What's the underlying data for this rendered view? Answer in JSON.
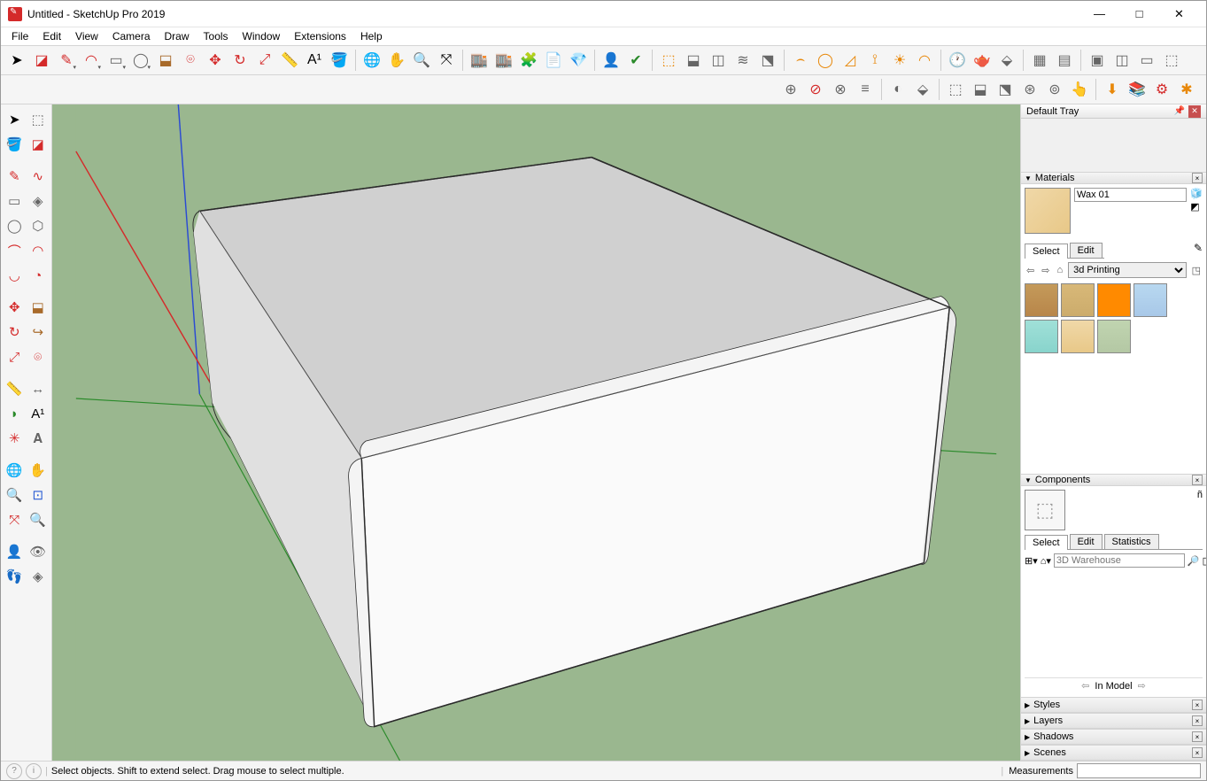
{
  "window": {
    "title": "Untitled - SketchUp Pro 2019",
    "controls": {
      "min": "—",
      "max": "□",
      "close": "✕"
    }
  },
  "menu": [
    "File",
    "Edit",
    "View",
    "Camera",
    "Draw",
    "Tools",
    "Window",
    "Extensions",
    "Help"
  ],
  "toolbar1": [
    {
      "name": "select-tool",
      "glyph": "➤",
      "cls": "",
      "dd": false,
      "sep": false
    },
    {
      "name": "eraser-tool",
      "glyph": "◪",
      "cls": "c-red",
      "dd": false,
      "sep": false
    },
    {
      "name": "line-tool",
      "glyph": "✎",
      "cls": "c-red",
      "dd": true,
      "sep": false
    },
    {
      "name": "arc-tool",
      "glyph": "◠",
      "cls": "c-red",
      "dd": true,
      "sep": false
    },
    {
      "name": "rectangle-tool",
      "glyph": "▭",
      "cls": "c-gray",
      "dd": true,
      "sep": false
    },
    {
      "name": "circle-tool",
      "glyph": "◯",
      "cls": "c-gray",
      "dd": true,
      "sep": false
    },
    {
      "name": "pushpull-tool",
      "glyph": "⬓",
      "cls": "c-brown",
      "dd": false,
      "sep": false
    },
    {
      "name": "offset-tool",
      "glyph": "⌾",
      "cls": "c-red",
      "dd": false,
      "sep": false
    },
    {
      "name": "move-tool",
      "glyph": "✥",
      "cls": "c-red",
      "dd": false,
      "sep": false
    },
    {
      "name": "rotate-tool",
      "glyph": "↻",
      "cls": "c-red",
      "dd": false,
      "sep": false
    },
    {
      "name": "scale-tool",
      "glyph": "⤢",
      "cls": "c-red",
      "dd": false,
      "sep": false
    },
    {
      "name": "tape-tool",
      "glyph": "📏",
      "cls": "",
      "dd": false,
      "sep": false
    },
    {
      "name": "text-tool",
      "glyph": "A¹",
      "cls": "",
      "dd": false,
      "sep": false
    },
    {
      "name": "paint-tool",
      "glyph": "🪣",
      "cls": "c-brown",
      "dd": false,
      "sep": false
    },
    {
      "sep": true
    },
    {
      "name": "orbit-tool",
      "glyph": "🌐",
      "cls": "c-red",
      "dd": false,
      "sep": false
    },
    {
      "name": "pan-tool",
      "glyph": "✋",
      "cls": "c-brown",
      "dd": false,
      "sep": false
    },
    {
      "name": "zoom-tool",
      "glyph": "🔍",
      "cls": "",
      "dd": false,
      "sep": false
    },
    {
      "name": "zoom-extents-tool",
      "glyph": "⤧",
      "cls": "",
      "dd": false,
      "sep": false
    },
    {
      "sep": true
    },
    {
      "name": "warehouse-1",
      "glyph": "🏬",
      "cls": "c-red",
      "dd": false,
      "sep": false
    },
    {
      "name": "warehouse-2",
      "glyph": "🏬",
      "cls": "c-red",
      "dd": false,
      "sep": false
    },
    {
      "name": "extension-warehouse",
      "glyph": "🧩",
      "cls": "c-red",
      "dd": false,
      "sep": false
    },
    {
      "name": "layout-tool",
      "glyph": "📄",
      "cls": "c-brown",
      "dd": false,
      "sep": false
    },
    {
      "name": "extension-manager",
      "glyph": "💎",
      "cls": "c-red",
      "dd": false,
      "sep": false
    },
    {
      "sep": true
    },
    {
      "name": "user-button",
      "glyph": "👤",
      "cls": "c-gray",
      "dd": false,
      "sep": false
    },
    {
      "name": "geo-location",
      "glyph": "✔",
      "cls": "c-green",
      "dd": false,
      "sep": false
    },
    {
      "sep": true
    },
    {
      "name": "section-plane",
      "glyph": "⬚",
      "cls": "c-orange",
      "dd": false,
      "sep": false
    },
    {
      "name": "section-display",
      "glyph": "⬓",
      "cls": "c-gray",
      "dd": false,
      "sep": false
    },
    {
      "name": "section-cuts",
      "glyph": "◫",
      "cls": "c-gray",
      "dd": false,
      "sep": false
    },
    {
      "name": "section-fill",
      "glyph": "≋",
      "cls": "c-gray",
      "dd": false,
      "sep": false
    },
    {
      "name": "section-tool-5",
      "glyph": "⬔",
      "cls": "c-gray",
      "dd": false,
      "sep": false
    },
    {
      "sep": true
    },
    {
      "name": "shadow-arc",
      "glyph": "⌢",
      "cls": "c-orange",
      "dd": false,
      "sep": false
    },
    {
      "name": "shadow-circle",
      "glyph": "◯",
      "cls": "c-orange",
      "dd": false,
      "sep": false
    },
    {
      "name": "shadow-angle",
      "glyph": "◿",
      "cls": "c-orange",
      "dd": false,
      "sep": false
    },
    {
      "name": "shadow-calc",
      "glyph": "⟟",
      "cls": "c-orange",
      "dd": false,
      "sep": false
    },
    {
      "name": "shadow-sun",
      "glyph": "☀",
      "cls": "c-orange",
      "dd": false,
      "sep": false
    },
    {
      "name": "shadow-dome",
      "glyph": "◠",
      "cls": "c-orange",
      "dd": false,
      "sep": false
    },
    {
      "sep": true
    },
    {
      "name": "clock-tool",
      "glyph": "🕐",
      "cls": "c-gray",
      "dd": false,
      "sep": false
    },
    {
      "name": "teapot-tool",
      "glyph": "🫖",
      "cls": "c-gray",
      "dd": false,
      "sep": false
    },
    {
      "name": "render-tool",
      "glyph": "⬙",
      "cls": "c-gray",
      "dd": false,
      "sep": false
    },
    {
      "sep": true
    },
    {
      "name": "style-1",
      "glyph": "▦",
      "cls": "c-gray",
      "dd": false,
      "sep": false
    },
    {
      "name": "style-2",
      "glyph": "▤",
      "cls": "c-gray",
      "dd": false,
      "sep": false
    },
    {
      "sep": true
    },
    {
      "name": "view-1",
      "glyph": "▣",
      "cls": "c-gray",
      "dd": false,
      "sep": false
    },
    {
      "name": "view-2",
      "glyph": "◫",
      "cls": "c-gray",
      "dd": false,
      "sep": false
    },
    {
      "name": "view-3",
      "glyph": "▭",
      "cls": "c-gray",
      "dd": false,
      "sep": false
    },
    {
      "name": "view-4",
      "glyph": "⬚",
      "cls": "c-gray",
      "dd": false,
      "sep": false
    }
  ],
  "toolbar2": [
    {
      "name": "solid-1",
      "glyph": "⊕",
      "cls": "c-gray"
    },
    {
      "name": "solid-2",
      "glyph": "⊘",
      "cls": "c-red"
    },
    {
      "name": "solid-3",
      "glyph": "⊗",
      "cls": "c-gray"
    },
    {
      "name": "solid-4",
      "glyph": "≡",
      "cls": "c-gray"
    },
    {
      "sep": true
    },
    {
      "name": "solid-5",
      "glyph": "◐",
      "cls": "c-gray"
    },
    {
      "name": "solid-6",
      "glyph": "⬙",
      "cls": "c-gray"
    },
    {
      "sep": true
    },
    {
      "name": "solid-7",
      "glyph": "⬚",
      "cls": "c-gray"
    },
    {
      "name": "solid-8",
      "glyph": "⬓",
      "cls": "c-gray"
    },
    {
      "name": "solid-9",
      "glyph": "⬔",
      "cls": "c-gray"
    },
    {
      "name": "solid-10",
      "glyph": "⊛",
      "cls": "c-gray"
    },
    {
      "name": "solid-11",
      "glyph": "⊚",
      "cls": "c-gray"
    },
    {
      "name": "solid-12",
      "glyph": "👆",
      "cls": "c-gray"
    },
    {
      "sep": true
    },
    {
      "name": "solid-13",
      "glyph": "⬇",
      "cls": "c-orange"
    },
    {
      "name": "solid-14",
      "glyph": "📚",
      "cls": "c-orange"
    },
    {
      "name": "solid-15",
      "glyph": "⚙",
      "cls": "c-red"
    },
    {
      "name": "solid-16",
      "glyph": "✱",
      "cls": "c-orange"
    }
  ],
  "leftPalette": [
    [
      {
        "name": "select-tool",
        "glyph": "➤",
        "cls": ""
      },
      {
        "name": "make-component",
        "glyph": "⬚",
        "cls": "c-gray"
      }
    ],
    [
      {
        "name": "paint-bucket",
        "glyph": "🪣",
        "cls": "c-brown"
      },
      {
        "name": "eraser",
        "glyph": "◪",
        "cls": "c-red"
      }
    ],
    "gap",
    [
      {
        "name": "line",
        "glyph": "✎",
        "cls": "c-red"
      },
      {
        "name": "freehand",
        "glyph": "∿",
        "cls": "c-red"
      }
    ],
    [
      {
        "name": "rectangle",
        "glyph": "▭",
        "cls": "c-gray"
      },
      {
        "name": "rotated-rect",
        "glyph": "◈",
        "cls": "c-gray"
      }
    ],
    [
      {
        "name": "circle",
        "glyph": "◯",
        "cls": "c-gray"
      },
      {
        "name": "polygon",
        "glyph": "⬡",
        "cls": "c-gray"
      }
    ],
    [
      {
        "name": "arc",
        "glyph": "⌒",
        "cls": "c-red"
      },
      {
        "name": "2pt-arc",
        "glyph": "◠",
        "cls": "c-red"
      }
    ],
    [
      {
        "name": "3pt-arc",
        "glyph": "◡",
        "cls": "c-red"
      },
      {
        "name": "pie",
        "glyph": "◔",
        "cls": "c-red"
      }
    ],
    "gap",
    [
      {
        "name": "move",
        "glyph": "✥",
        "cls": "c-red"
      },
      {
        "name": "pushpull",
        "glyph": "⬓",
        "cls": "c-brown"
      }
    ],
    [
      {
        "name": "rotate",
        "glyph": "↻",
        "cls": "c-red"
      },
      {
        "name": "followme",
        "glyph": "↪",
        "cls": "c-brown"
      }
    ],
    [
      {
        "name": "scale",
        "glyph": "⤢",
        "cls": "c-red"
      },
      {
        "name": "offset",
        "glyph": "⌾",
        "cls": "c-red"
      }
    ],
    "gap",
    [
      {
        "name": "tape",
        "glyph": "📏",
        "cls": "c-brown"
      },
      {
        "name": "dimension",
        "glyph": "↔",
        "cls": "c-gray"
      }
    ],
    [
      {
        "name": "protractor",
        "glyph": "◗",
        "cls": "c-green"
      },
      {
        "name": "text",
        "glyph": "A¹",
        "cls": ""
      }
    ],
    [
      {
        "name": "axes",
        "glyph": "✳",
        "cls": "c-red"
      },
      {
        "name": "3dtext",
        "glyph": "𝐀",
        "cls": "c-gray"
      }
    ],
    "gap",
    [
      {
        "name": "orbit",
        "glyph": "🌐",
        "cls": "c-red"
      },
      {
        "name": "pan",
        "glyph": "✋",
        "cls": "c-brown"
      }
    ],
    [
      {
        "name": "zoom",
        "glyph": "🔍",
        "cls": "c-blue"
      },
      {
        "name": "zoom-window",
        "glyph": "⊡",
        "cls": "c-blue"
      }
    ],
    [
      {
        "name": "zoom-extents",
        "glyph": "⤧",
        "cls": "c-red"
      },
      {
        "name": "previous",
        "glyph": "🔍",
        "cls": "c-blue"
      }
    ],
    "gap",
    [
      {
        "name": "position-camera",
        "glyph": "👤",
        "cls": "c-gray"
      },
      {
        "name": "look-around",
        "glyph": "👁",
        "cls": "c-gray"
      }
    ],
    [
      {
        "name": "walk",
        "glyph": "👣",
        "cls": ""
      },
      {
        "name": "section",
        "glyph": "◈",
        "cls": "c-gray"
      }
    ]
  ],
  "tray": {
    "title": "Default Tray",
    "materials": {
      "title": "Materials",
      "name": "Wax 01",
      "tabs": [
        "Select",
        "Edit"
      ],
      "activeTab": 0,
      "library": "3d Printing",
      "swatches": [
        {
          "name": "wood-1",
          "bg": "linear-gradient(#c49a5a,#b8864a)"
        },
        {
          "name": "wood-2",
          "bg": "linear-gradient(#d8b878,#ccac6c)"
        },
        {
          "name": "orange",
          "bg": "#ff8a00"
        },
        {
          "name": "sky",
          "bg": "linear-gradient(#b8d8f0,#a8c8e8)"
        },
        {
          "name": "aqua",
          "bg": "linear-gradient(#a0e0d8,#88d4cc)"
        },
        {
          "name": "wax",
          "bg": "linear-gradient(#f0d8a8,#e8c888)"
        },
        {
          "name": "sage",
          "bg": "linear-gradient(#c0d4b0,#b4c8a4)"
        }
      ]
    },
    "components": {
      "title": "Components",
      "tabs": [
        "Select",
        "Edit",
        "Statistics"
      ],
      "activeTab": 0,
      "searchPlaceholder": "3D Warehouse",
      "bottomLabel": "In Model"
    },
    "collapsed": [
      "Styles",
      "Layers",
      "Shadows",
      "Scenes"
    ]
  },
  "statusbar": {
    "hint": "Select objects. Shift to extend select. Drag mouse to select multiple.",
    "measLabel": "Measurements"
  }
}
